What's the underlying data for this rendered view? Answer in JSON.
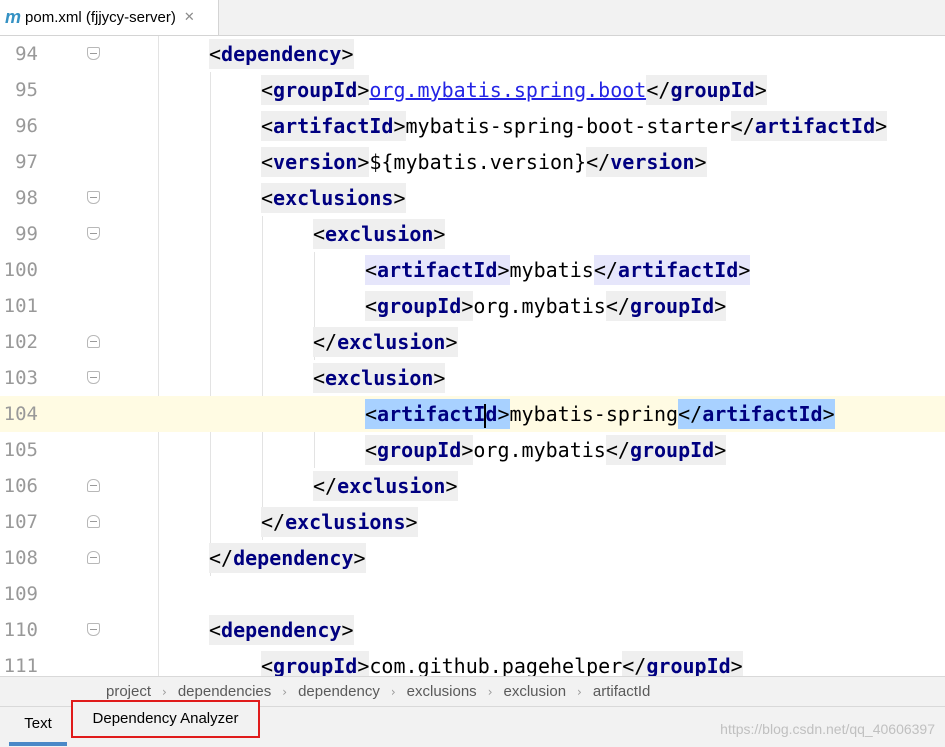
{
  "tab": {
    "icon": "maven-m-icon",
    "icon_glyph": "m",
    "title": "pom.xml (fjjycy-server)",
    "close_glyph": "✕"
  },
  "editor": {
    "lines": [
      {
        "num": "94",
        "indent": 2,
        "fold": "open",
        "tokens": [
          [
            "tag",
            "dependency"
          ]
        ]
      },
      {
        "num": "95",
        "indent": 3,
        "fold": "",
        "tokens": [
          [
            "tag",
            "groupId"
          ],
          [
            "link",
            "org.mybatis.spring.boot"
          ],
          [
            "ctag",
            "groupId"
          ]
        ]
      },
      {
        "num": "96",
        "indent": 3,
        "fold": "",
        "tokens": [
          [
            "tag",
            "artifactId"
          ],
          [
            "text",
            "mybatis-spring-boot-starter"
          ],
          [
            "ctag",
            "artifactId"
          ]
        ]
      },
      {
        "num": "97",
        "indent": 3,
        "fold": "",
        "tokens": [
          [
            "tag",
            "version"
          ],
          [
            "text",
            "${mybatis.version}"
          ],
          [
            "ctag",
            "version"
          ]
        ]
      },
      {
        "num": "98",
        "indent": 3,
        "fold": "open",
        "tokens": [
          [
            "tag",
            "exclusions"
          ]
        ]
      },
      {
        "num": "99",
        "indent": 4,
        "fold": "open",
        "tokens": [
          [
            "tag",
            "exclusion"
          ]
        ]
      },
      {
        "num": "100",
        "indent": 5,
        "fold": "",
        "tokens": [
          [
            "tag",
            "artifactId",
            "purple"
          ],
          [
            "text",
            "mybatis"
          ],
          [
            "ctag",
            "artifactId",
            "purple"
          ]
        ]
      },
      {
        "num": "101",
        "indent": 5,
        "fold": "",
        "tokens": [
          [
            "tag",
            "groupId"
          ],
          [
            "text",
            "org.mybatis"
          ],
          [
            "ctag",
            "groupId"
          ]
        ]
      },
      {
        "num": "102",
        "indent": 4,
        "fold": "close",
        "tokens": [
          [
            "ctag",
            "exclusion"
          ]
        ]
      },
      {
        "num": "103",
        "indent": 4,
        "fold": "open",
        "tokens": [
          [
            "tag",
            "exclusion"
          ]
        ]
      },
      {
        "num": "104",
        "indent": 5,
        "fold": "",
        "current": true,
        "tokens": [
          [
            "tagcaret",
            "artifactI",
            "d"
          ],
          [
            "text",
            "mybatis-spring"
          ],
          [
            "ctag",
            "artifactId",
            "blue"
          ]
        ]
      },
      {
        "num": "105",
        "indent": 5,
        "fold": "",
        "tokens": [
          [
            "tag",
            "groupId"
          ],
          [
            "text",
            "org.mybatis"
          ],
          [
            "ctag",
            "groupId"
          ]
        ]
      },
      {
        "num": "106",
        "indent": 4,
        "fold": "close",
        "tokens": [
          [
            "ctag",
            "exclusion"
          ]
        ]
      },
      {
        "num": "107",
        "indent": 3,
        "fold": "close",
        "tokens": [
          [
            "ctag",
            "exclusions"
          ]
        ]
      },
      {
        "num": "108",
        "indent": 2,
        "fold": "close",
        "tokens": [
          [
            "ctag",
            "dependency"
          ]
        ]
      },
      {
        "num": "109",
        "indent": 0,
        "fold": "",
        "tokens": []
      },
      {
        "num": "110",
        "indent": 2,
        "fold": "open",
        "tokens": [
          [
            "tag",
            "dependency"
          ]
        ]
      },
      {
        "num": "111",
        "indent": 3,
        "fold": "",
        "tokens": [
          [
            "tag",
            "groupId"
          ],
          [
            "text",
            "com.github.pagehelper"
          ],
          [
            "ctag",
            "groupId"
          ]
        ]
      }
    ]
  },
  "breadcrumb": [
    "project",
    "dependencies",
    "dependency",
    "exclusions",
    "exclusion",
    "artifactId"
  ],
  "bottom_tabs": {
    "text_label": "Text",
    "analyzer_label": "Dependency Analyzer"
  },
  "watermark": "https://blog.csdn.net/qq_40606397",
  "colors": {
    "tag": "#000080",
    "link": "#2424e5",
    "highlight_current_line": "#fffbe3",
    "highlight_box": "#e01b1b"
  }
}
